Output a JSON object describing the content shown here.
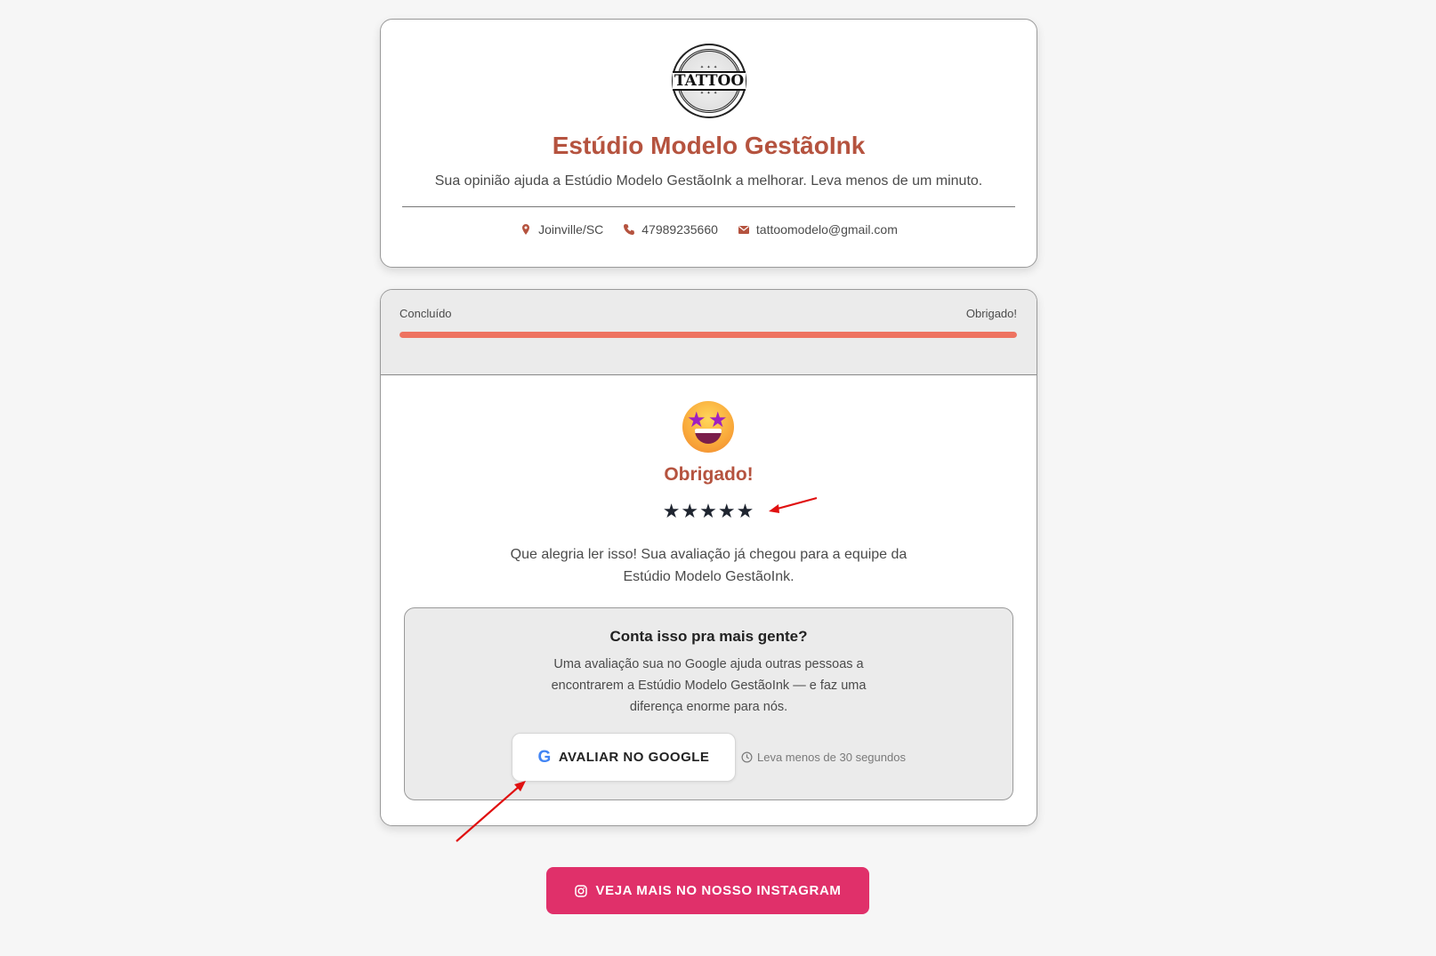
{
  "header": {
    "logo_text": "TATTOO",
    "title": "Estúdio Modelo GestãoInk",
    "subtitle": "Sua opinião ajuda a Estúdio Modelo GestãoInk a melhorar. Leva menos de um minuto.",
    "contacts": {
      "location": "Joinville/SC",
      "phone": "47989235660",
      "email": "tattoomodelo@gmail.com"
    }
  },
  "progress": {
    "left_label": "Concluído",
    "right_label": "Obrigado!",
    "fraction": 1.0
  },
  "result": {
    "emoji": "star-struck-emoji",
    "title": "Obrigado!",
    "rating": 5,
    "stars": "★★★★★",
    "message": "Que alegria ler isso! Sua avaliação já chegou para a equipe da Estúdio Modelo GestãoInk."
  },
  "google_box": {
    "title": "Conta isso pra mais gente?",
    "text": "Uma avaliação sua no Google ajuda outras pessoas a encontrarem a Estúdio Modelo GestãoInk — e faz uma diferença enorme para nós.",
    "button_label": "AVALIAR NO GOOGLE",
    "hint": "Leva menos de 30 segundos"
  },
  "instagram_button": {
    "label": "VEJA MAIS NO NOSSO INSTAGRAM"
  },
  "colors": {
    "accent": "#b5533f",
    "progress": "#ee7361",
    "instagram": "#e0306a",
    "annotation_arrow": "#e01010"
  }
}
